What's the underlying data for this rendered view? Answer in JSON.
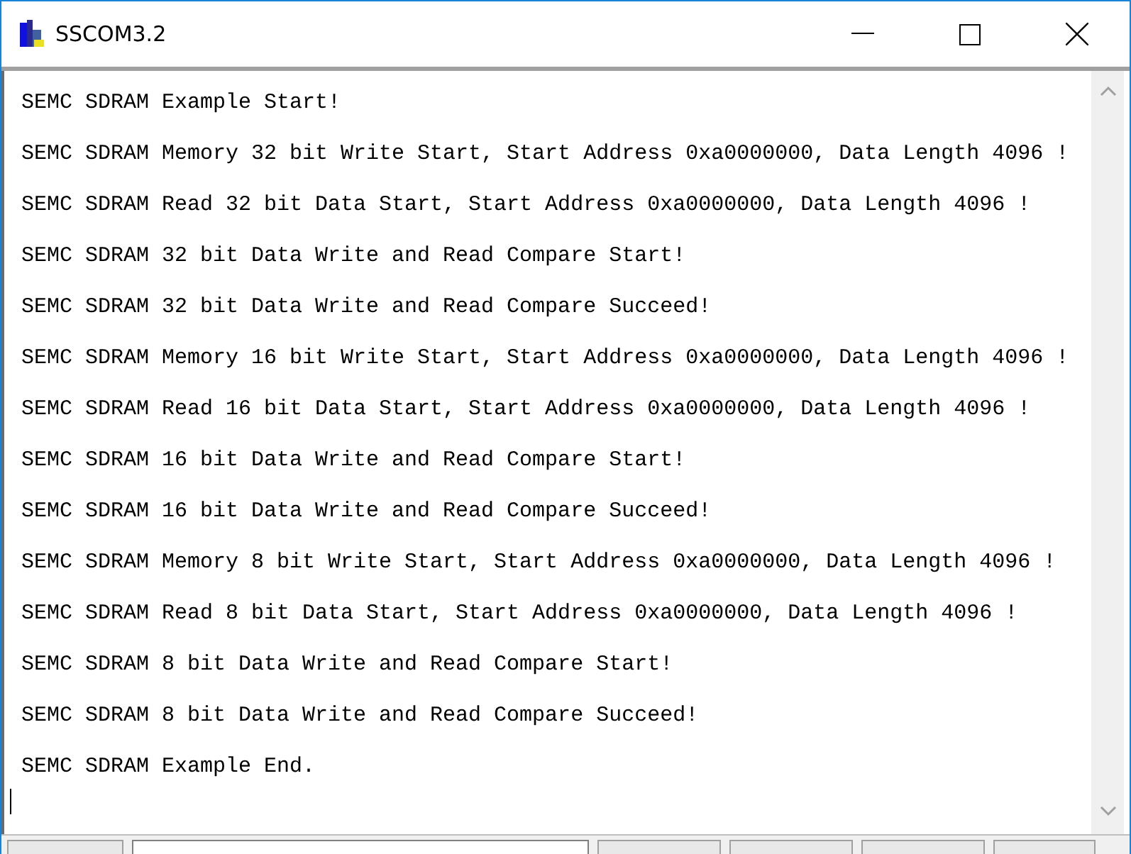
{
  "window": {
    "title": "SSCOM3.2"
  },
  "log": {
    "lines": [
      "SEMC SDRAM Example Start!",
      "SEMC SDRAM Memory 32 bit Write Start, Start Address 0xa0000000, Data Length 4096 !",
      "SEMC SDRAM Read 32 bit Data Start, Start Address 0xa0000000, Data Length 4096 !",
      "SEMC SDRAM 32 bit Data Write and Read Compare Start!",
      "SEMC SDRAM 32 bit Data Write and Read Compare Succeed!",
      "SEMC SDRAM Memory 16 bit Write Start, Start Address 0xa0000000, Data Length 4096 !",
      "SEMC SDRAM Read 16 bit Data Start, Start Address 0xa0000000, Data Length 4096 !",
      "SEMC SDRAM 16 bit Data Write and Read Compare Start!",
      "SEMC SDRAM 16 bit Data Write and Read Compare Succeed!",
      "SEMC SDRAM Memory 8 bit Write Start, Start Address 0xa0000000, Data Length 4096 !",
      "SEMC SDRAM Read 8 bit Data Start, Start Address 0xa0000000, Data Length 4096 !",
      "SEMC SDRAM 8 bit Data Write and Read Compare Start!",
      "SEMC SDRAM 8 bit Data Write and Read Compare Succeed!",
      "SEMC SDRAM Example End."
    ]
  }
}
